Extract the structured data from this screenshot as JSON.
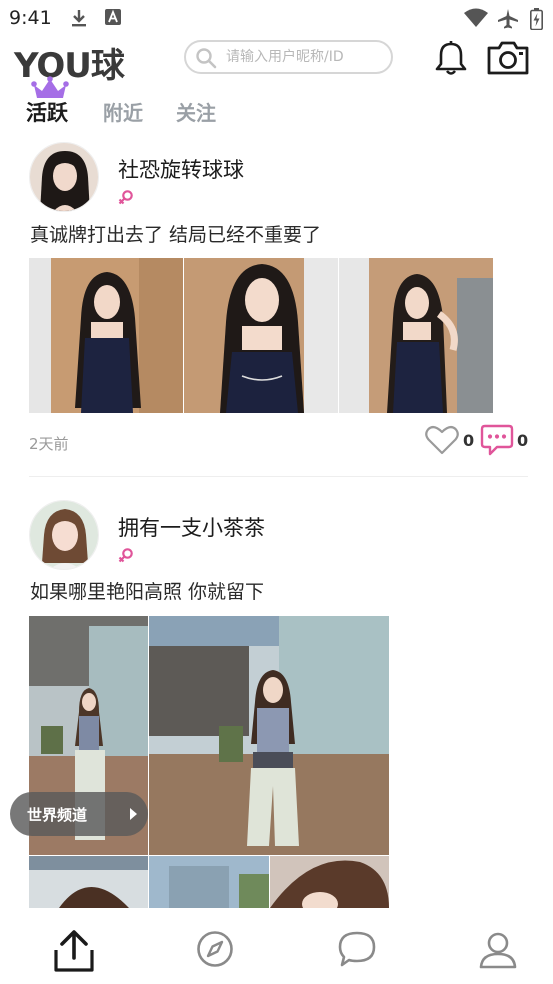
{
  "status_bar": {
    "time": "9:41"
  },
  "header": {
    "logo": "YOU球",
    "search_placeholder": "请输入用户昵称/ID"
  },
  "tabs": [
    {
      "label": "活跃",
      "active": true
    },
    {
      "label": "附近",
      "active": false
    },
    {
      "label": "关注",
      "active": false
    }
  ],
  "posts": [
    {
      "username": "社恐旋转球球",
      "gender": "female",
      "caption": "真诚牌打出去了 结局已经不重要了",
      "time": "2天前",
      "likes": "0",
      "comments": "0"
    },
    {
      "username": "拥有一支小茶茶",
      "gender": "female",
      "caption": "如果哪里艳阳高照 你就留下"
    }
  ],
  "world_channel": {
    "label": "世界频道"
  },
  "colors": {
    "accent_pink": "#e0559a",
    "crown_purple": "#a56ee6",
    "text_dark": "#1c1c1c",
    "inactive_tab": "#9aa0a6"
  },
  "bottom_nav": {
    "items": [
      "upload-icon",
      "discover-compass-icon",
      "message-bubble-icon",
      "profile-user-icon"
    ]
  }
}
